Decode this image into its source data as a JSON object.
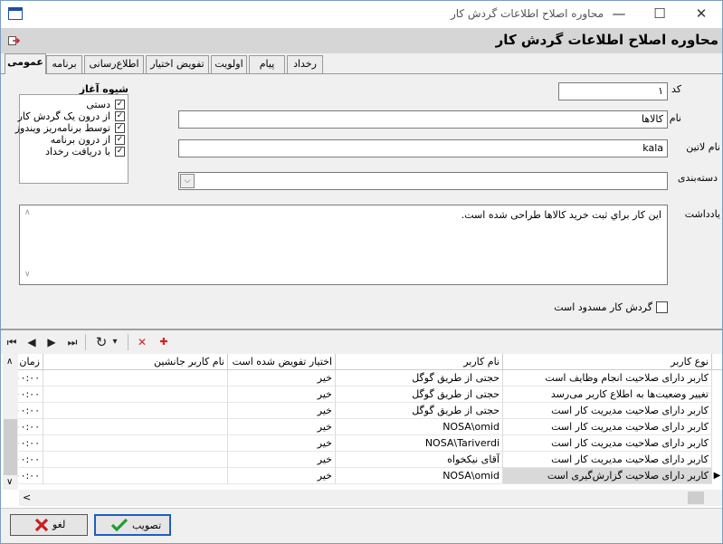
{
  "window": {
    "title": "محاوره اصلاح اطلاعات گردش کار",
    "minimize": "—",
    "maximize": "☐",
    "close": "✕"
  },
  "header": {
    "title": "محاوره اصلاح اطلاعات گردش کار"
  },
  "tabs": [
    {
      "label": "عمومی",
      "active": true
    },
    {
      "label": "برنامه"
    },
    {
      "label": "اطلاع‌رسانی"
    },
    {
      "label": "تفویض اختیار"
    },
    {
      "label": "اولویت"
    },
    {
      "label": "پیام"
    },
    {
      "label": "رخداد"
    }
  ],
  "form": {
    "code_label": "کد",
    "code_value": "۱",
    "name_label": "نام",
    "name_value": "کالاها",
    "latin_label": "نام لاتین",
    "latin_value": "kala",
    "category_label": "دسته‌بندی",
    "category_value": "",
    "notes_label": "یادداشت",
    "notes_value": "اين كار براي ثبت خريد كالاها طراحی شده است.",
    "blocked_label": "گردش کار مسدود است",
    "blocked_checked": false
  },
  "start_method": {
    "title": "شیوه آغاز",
    "options": [
      {
        "label": "دستی",
        "checked": true
      },
      {
        "label": "از درون یک گردش کار",
        "checked": true
      },
      {
        "label": "توسط برنامه‌ریز ویندوز",
        "checked": true
      },
      {
        "label": "از درون برنامه",
        "checked": true
      },
      {
        "label": "با دریافت رخداد",
        "checked": true
      }
    ]
  },
  "toolbar": {
    "first": "⏮",
    "prev": "◀",
    "next": "▶",
    "last": "⏭",
    "refresh": "↻",
    "dropdown": "▾",
    "delete": "✕",
    "add": "✚"
  },
  "grid": {
    "columns": {
      "user_type": "نوع کاربر",
      "user_name": "نام کاربر",
      "delegated": "اختیار تفویض شده است",
      "substitute": "نام کاربر جانشین",
      "time": "زمان ا"
    },
    "rows": [
      {
        "user_type": "کاربر دارای صلاحیت انجام وظایف است",
        "user_name": "حجتی از طریق گوگل",
        "delegated": "خیر",
        "substitute": "",
        "time": "۰۰:۰۰",
        "selected": false
      },
      {
        "user_type": "تغییر وضعیت‌ها به اطلاع کاربر می‌رسد",
        "user_name": "حجتی از طریق گوگل",
        "delegated": "خیر",
        "substitute": "",
        "time": "۰۰:۰۰",
        "selected": false
      },
      {
        "user_type": "کاربر دارای صلاحیت مدیریت کار است",
        "user_name": "حجتی از طریق گوگل",
        "delegated": "خیر",
        "substitute": "",
        "time": "۰۰:۰۰",
        "selected": false
      },
      {
        "user_type": "کاربر دارای صلاحیت مدیریت کار است",
        "user_name": "NOSA\\omid",
        "delegated": "خیر",
        "substitute": "",
        "time": "۰۰:۰۰",
        "selected": false
      },
      {
        "user_type": "کاربر دارای صلاحیت مدیریت کار است",
        "user_name": "NOSA\\Tariverdi",
        "delegated": "خیر",
        "substitute": "",
        "time": "۰۰:۰۰",
        "selected": false
      },
      {
        "user_type": "کاربر دارای صلاحیت مدیریت کار است",
        "user_name": "آقای نیکخواه",
        "delegated": "خیر",
        "substitute": "",
        "time": "۰۰:۰۰",
        "selected": false
      },
      {
        "user_type": "کاربر دارای صلاحیت گزارش‌گیری است",
        "user_name": "NOSA\\omid",
        "delegated": "خیر",
        "substitute": "",
        "time": "۰۰:۰۰",
        "selected": true
      }
    ],
    "current_row_marker": "▶",
    "scroll_up": "∧",
    "scroll_down": "∨",
    "scroll_left": "<",
    "scroll_right": ">"
  },
  "footer": {
    "approve_label": "تصویب",
    "cancel_label": "لغو"
  },
  "colors": {
    "approve_check": "#1e9e2e",
    "cancel_x": "#c81e1e",
    "delete_x": "#d62020",
    "add_plus": "#d62020",
    "accent": "#1d5fbf"
  }
}
